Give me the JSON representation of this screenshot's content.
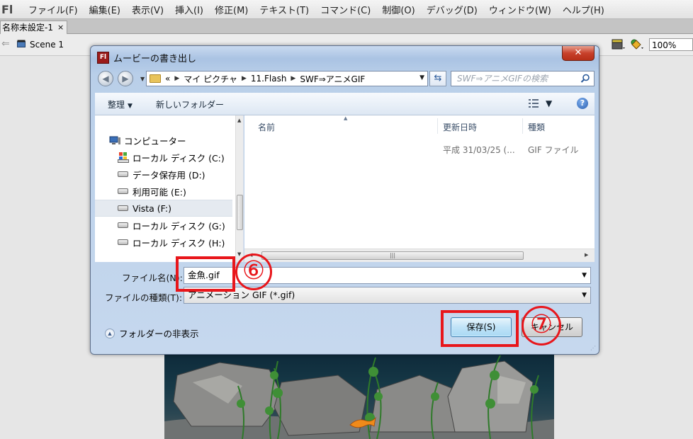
{
  "app": {
    "logo": "Fl",
    "menu": [
      "ファイル(F)",
      "編集(E)",
      "表示(V)",
      "挿入(I)",
      "修正(M)",
      "テキスト(T)",
      "コマンド(C)",
      "制御(O)",
      "デバッグ(D)",
      "ウィンドウ(W)",
      "ヘルプ(H)"
    ],
    "doc_tab": "名称未設定-1",
    "tab_close": "×",
    "scene": "Scene 1",
    "zoom": "100%"
  },
  "dialog": {
    "title": "ムービーの書き出し",
    "close": "✕",
    "breadcrumb": [
      "«",
      "マイ ピクチャ",
      "11.Flash",
      "SWF⇒アニメGIF"
    ],
    "search_placeholder": "SWF⇒アニメGIFの検索",
    "toolbar": {
      "organize": "整理",
      "new_folder": "新しいフォルダー"
    },
    "nav_items": [
      {
        "label": "コンピューター",
        "icon": "computer-icon"
      },
      {
        "label": "ローカル ディスク (C:)",
        "icon": "windows-drive-icon"
      },
      {
        "label": "データ保存用 (D:)",
        "icon": "drive-icon"
      },
      {
        "label": "利用可能 (E:)",
        "icon": "drive-icon"
      },
      {
        "label": "Vista (F:)",
        "icon": "drive-icon",
        "selected": true
      },
      {
        "label": "ローカル ディスク (G:)",
        "icon": "drive-icon"
      },
      {
        "label": "ローカル ディスク (H:)",
        "icon": "drive-icon"
      }
    ],
    "columns": {
      "name": "名前",
      "date": "更新日時",
      "type": "種類"
    },
    "files": [
      {
        "name": "",
        "date": "平成 31/03/25 (...",
        "type": "GIF ファイル"
      }
    ],
    "hscroll_grip": "|||",
    "filename_label": "ファイル名(N):",
    "filename_value": "金魚.gif",
    "filetype_label": "ファイルの種類(T):",
    "filetype_value": "アニメーション GIF (*.gif)",
    "hide_folders": "フォルダーの非表示",
    "save_button": "保存(S)",
    "cancel_button": "キャンセル"
  },
  "annotations": {
    "step6": "⑥",
    "step7": "⑦",
    "color": "#e8161b"
  }
}
